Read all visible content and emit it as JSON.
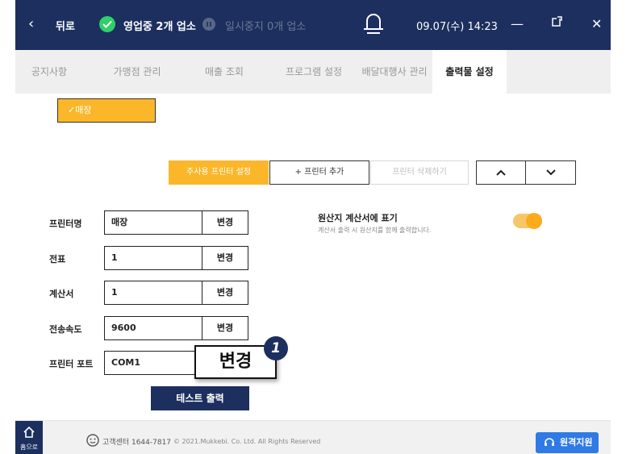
{
  "topbar": {
    "back_label": "뒤로",
    "status_open": "영업중 2개 업소",
    "status_paused": "일시중지 0개 업소",
    "datetime": "09.07(수) 14:23"
  },
  "tabs": [
    {
      "label": "공지사항",
      "active": false
    },
    {
      "label": "가맹점 관리",
      "active": false
    },
    {
      "label": "매출 조회",
      "active": false
    },
    {
      "label": "프로그램 설정",
      "active": false
    },
    {
      "label": "배달대행사 관리",
      "active": false
    },
    {
      "label": "출력물 설정",
      "active": true
    }
  ],
  "store_chip": "✓매장",
  "actions": {
    "main_printer": "주사용 프린터 설정",
    "add_printer": "+ 프린터 추가",
    "delete_printer": "프린터 삭제하기",
    "up": "⌃",
    "down": "⌄"
  },
  "fields": [
    {
      "label": "프린터명",
      "value": "매장",
      "button": "변경"
    },
    {
      "label": "전표",
      "value": "1",
      "button": "변경"
    },
    {
      "label": "계산서",
      "value": "1",
      "button": "변경"
    },
    {
      "label": "전송속도",
      "value": "9600",
      "button": "변경"
    },
    {
      "label": "프린터 포트",
      "value": "COM1",
      "button": "변경"
    }
  ],
  "step_badge": "1",
  "test_print": "테스트 출력",
  "origin": {
    "title": "원산지 계산서에 표기",
    "desc": "계산서 출력 시 원산지를 함께 출력합니다.",
    "enabled": true
  },
  "footer": {
    "home_label": "홈으로",
    "support": "고객센터 1644-7817",
    "copyright": "© 2021.Mukkebi. Co. Ltd. All Rights Reserved",
    "remote": "원격지원"
  },
  "colors": {
    "navy": "#1c2f5e",
    "accent": "#fbb62a",
    "remote_blue": "#2f7ae5"
  }
}
